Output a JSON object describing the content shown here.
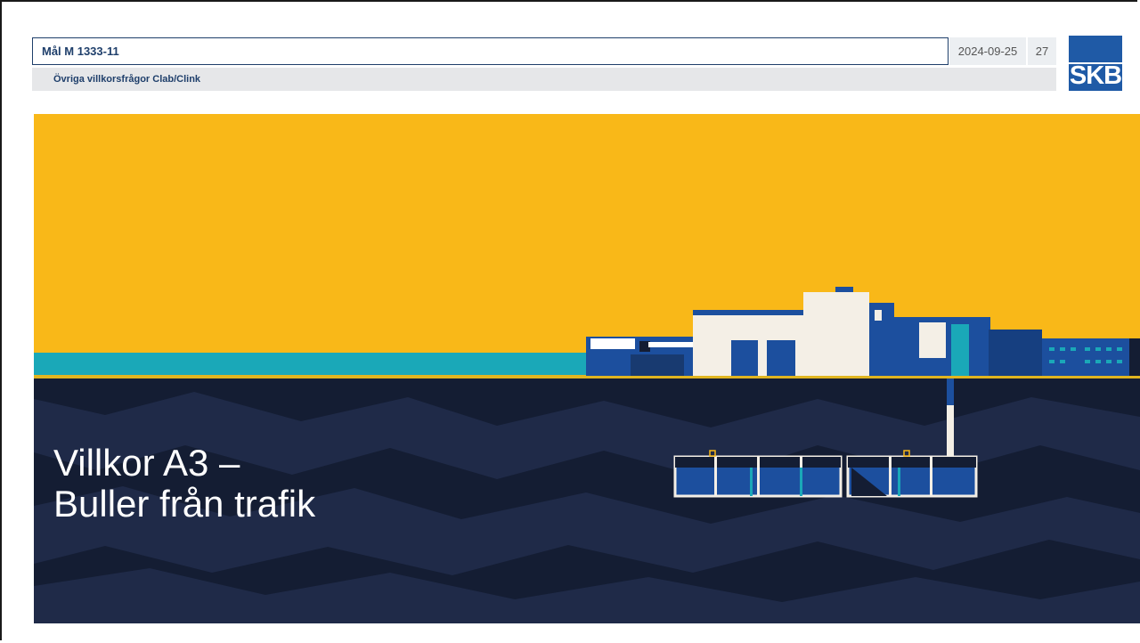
{
  "header": {
    "case_number": "Mål M 1333-11",
    "date": "2024-09-25",
    "page_number": "27",
    "subtitle": "Övriga villkorsfrågor Clab/Clink"
  },
  "logo": {
    "text": "SKB",
    "color": "#1f5aa6"
  },
  "slide": {
    "title_line1": "Villkor A3 –",
    "title_line2": "Buller från trafik"
  },
  "colors": {
    "sky": "#f9b818",
    "water": "#1aa8b8",
    "bedrock_dark": "#111a2e",
    "bedrock_light": "#1f2a48",
    "building_white": "#f4efe6",
    "building_blue": "#1c4f9e"
  }
}
